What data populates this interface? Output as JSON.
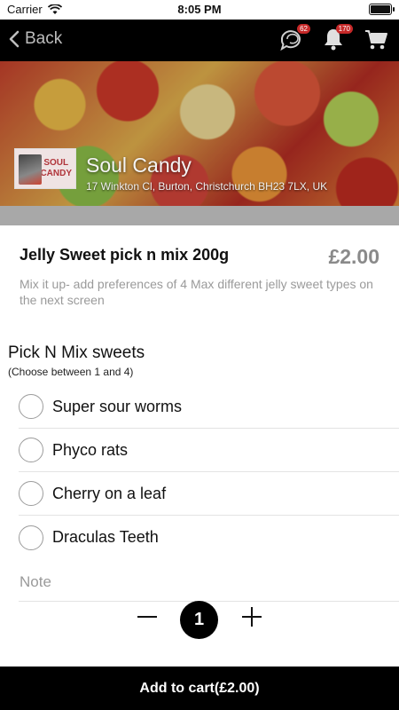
{
  "status_bar": {
    "carrier": "Carrier",
    "time": "8:05 PM"
  },
  "nav": {
    "back_label": "Back",
    "chat_badge": "62",
    "notification_badge": "170"
  },
  "store": {
    "name": "Soul Candy",
    "address": "17 Winkton Cl, Burton, Christchurch BH23 7LX, UK",
    "logo_text_line1": "SOUL",
    "logo_text_line2": "CANDY"
  },
  "product": {
    "title": "Jelly Sweet pick n mix 200g",
    "price": "£2.00",
    "description": "Mix it up- add preferences of 4 Max different jelly sweet types on the next screen"
  },
  "options": {
    "title": "Pick N Mix sweets",
    "hint": "(Choose between 1 and 4)",
    "items": [
      {
        "label": "Super sour worms"
      },
      {
        "label": "Phyco rats"
      },
      {
        "label": "Cherry on a leaf"
      },
      {
        "label": "Draculas Teeth"
      }
    ]
  },
  "note": {
    "placeholder": "Note",
    "value": ""
  },
  "quantity": {
    "value": "1"
  },
  "cart": {
    "label": "Add to cart(£2.00)"
  }
}
